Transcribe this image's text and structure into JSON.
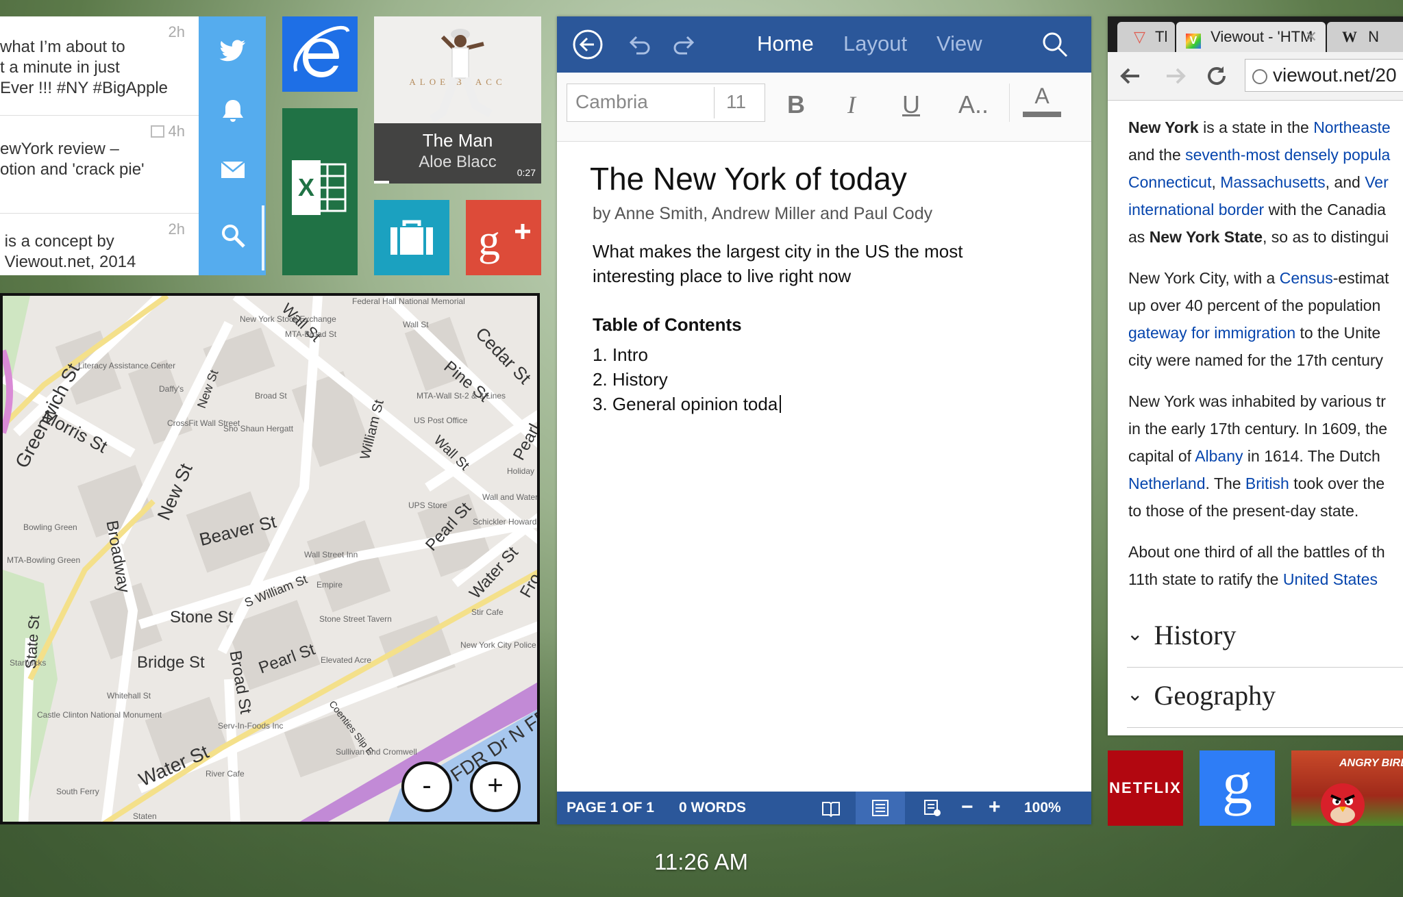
{
  "feed": {
    "items": [
      {
        "lines": "what I’m about to\nt a minute in just\nEver !!! #NY #BigApple",
        "time": "2h"
      },
      {
        "lines": "ewYork review –\notion and 'crack pie'",
        "time": "4h"
      },
      {
        "lines": " is a concept by\n Viewout.net, 2014",
        "time": "2h"
      }
    ]
  },
  "music": {
    "title": "The Man",
    "artist": "Aloe Blacc",
    "duration": "0:27",
    "album_text": "ALOE   BLACC"
  },
  "map": {
    "streets": [
      {
        "label": "Greenwich St"
      },
      {
        "label": "Morris St"
      },
      {
        "label": "New St"
      },
      {
        "label": "Broadway"
      },
      {
        "label": "Beaver St"
      },
      {
        "label": "Stone St"
      },
      {
        "label": "Bridge St"
      },
      {
        "label": "Broad St"
      },
      {
        "label": "Pearl St"
      },
      {
        "label": "Water St"
      },
      {
        "label": "State St"
      },
      {
        "label": "Wall St"
      },
      {
        "label": "Cedar St"
      },
      {
        "label": "Pine St"
      },
      {
        "label": "William St"
      },
      {
        "label": "Pearl St"
      },
      {
        "label": "Water St"
      },
      {
        "label": "S William St"
      },
      {
        "label": "FDR Dr N FDR"
      },
      {
        "label": "Fro"
      },
      {
        "label": "Wall St"
      },
      {
        "label": "New St"
      },
      {
        "label": "Pearl"
      },
      {
        "label": "Coenties Slip E"
      }
    ],
    "pois": [
      "Federal\nHall\nNational\nMemorial",
      "New\nYork\nStock\nExchange",
      "MTA-Broad St",
      "Wall St",
      "Literacy\nAssistance\nCenter",
      "Daffy's",
      "Broad St",
      "MTA-Wall St-2 & 3 Lines",
      "CrossFit Wall\nStreet",
      "Sho Shaun\nHergatt",
      "US Post\nOffice",
      "Holiday In",
      "Wall and Water",
      "UPS Store",
      "Schickler\nHoward Fine Art",
      "Bowling Green",
      "MTA-Bowling Green",
      "Wall Street Inn",
      "Empire",
      "Stone Street\nTavern",
      "Stir Cafe",
      "New York City\nPolice\nMuseum",
      "Elevated Acre",
      "Starbucks",
      "Whitehall St",
      "Castle\nClinton\nNational\nMonument",
      "Serv-In-Foods Inc",
      "Sullivan and\nCromwell",
      "River Cafe",
      "South Ferry",
      "Staten"
    ],
    "zoom_out": "-",
    "zoom_in": "+"
  },
  "doc": {
    "tabs": [
      "Home",
      "Layout",
      "View"
    ],
    "font": "Cambria",
    "size": "11",
    "title": "The New York of today",
    "authors": "by Anne Smith, Andrew Miller and Paul Cody",
    "subtitle": "What makes the largest city in the US the most interesting place to live right now",
    "toc_heading": "Table of Contents",
    "toc": [
      "1. Intro",
      "2. History",
      "3. General opinion toda"
    ],
    "status_page": "PAGE 1 OF 1",
    "status_words": "0 WORDS",
    "zoom": "100%"
  },
  "browser": {
    "tabs": [
      "Tl",
      "Viewout - 'HTM",
      "N"
    ],
    "url": "viewout.net/20",
    "para1": [
      {
        "b": "New York"
      },
      {
        "t": " is a state in the "
      },
      {
        "a": "Northeaste"
      },
      {
        "br": true
      },
      {
        "t": "and the "
      },
      {
        "a": "seventh-most densely popula"
      },
      {
        "br": true
      },
      {
        "a": "Connecticut"
      },
      {
        "t": ", "
      },
      {
        "a": "Massachusetts"
      },
      {
        "t": ", and "
      },
      {
        "a": "Ver"
      },
      {
        "br": true
      },
      {
        "a": "international border"
      },
      {
        "t": " with the Canadia"
      },
      {
        "br": true
      },
      {
        "t": "as "
      },
      {
        "b": "New York State"
      },
      {
        "t": ", so as to distingui"
      }
    ],
    "para2": [
      {
        "t": "New York City, with a "
      },
      {
        "a": "Census"
      },
      {
        "t": "-estimat"
      },
      {
        "br": true
      },
      {
        "t": "up over 40 percent of the population"
      },
      {
        "br": true
      },
      {
        "a": "gateway for immigration"
      },
      {
        "t": " to the Unite"
      },
      {
        "br": true
      },
      {
        "t": "city were named for the 17th century"
      }
    ],
    "para3": [
      {
        "t": "New York was inhabited by various tr"
      },
      {
        "br": true
      },
      {
        "t": "in the early 17th century. In 1609, the"
      },
      {
        "br": true
      },
      {
        "t": "capital of "
      },
      {
        "a": "Albany"
      },
      {
        "t": " in 1614. The Dutch"
      },
      {
        "br": true
      },
      {
        "a": "Netherland"
      },
      {
        "t": ". The "
      },
      {
        "a": "British"
      },
      {
        "t": " took over the"
      },
      {
        "br": true
      },
      {
        "t": "to those of the present-day state."
      }
    ],
    "para4": [
      {
        "t": "About one third of all the battles of th"
      },
      {
        "br": true
      },
      {
        "t": "11th state to ratify the "
      },
      {
        "a": "United States"
      }
    ],
    "sections": [
      "History",
      "Geography"
    ]
  },
  "tiles": {
    "netflix": "NETFLIX",
    "angry": "ANGRY BIRD"
  },
  "clock": "11:26 AM",
  "colors": {
    "twitter": "#55acee",
    "ie": "#1e6fe6",
    "excel": "#207245",
    "briefcase": "#1ba1c0",
    "gplus": "#dd4b39",
    "word": "#2b579a",
    "netflix": "#b20710",
    "google": "#2e7df6"
  }
}
